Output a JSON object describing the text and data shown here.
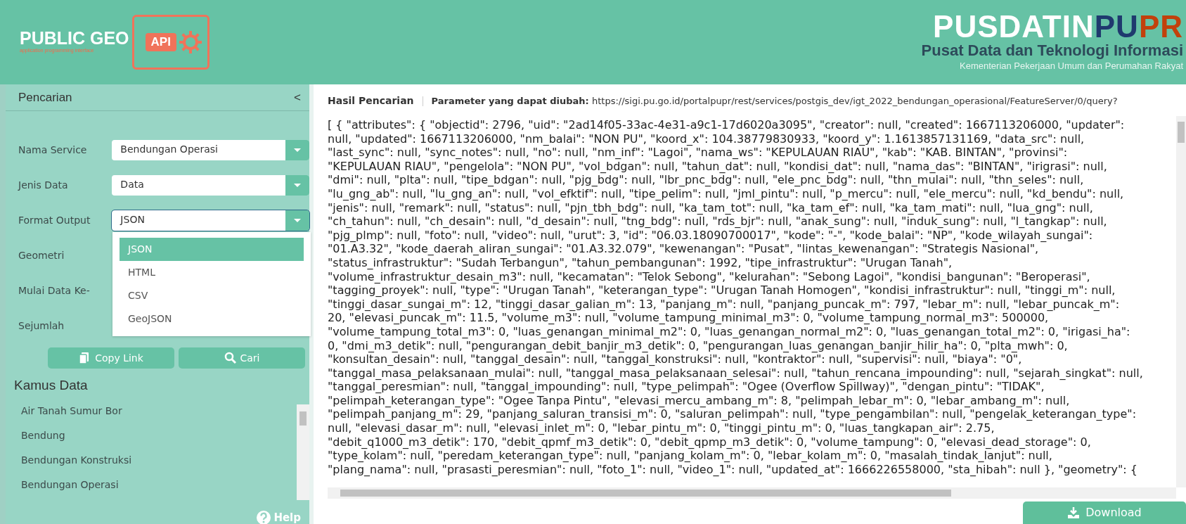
{
  "header": {
    "app_logo": {
      "title": "PUBLIC GEO",
      "badge": "API",
      "tagline": "application programming interface"
    },
    "org_logo": {
      "wordmark": [
        {
          "text": "PUSDATIN",
          "color": "#ffffff"
        },
        {
          "text": "PU",
          "color": "#1f3a6e"
        },
        {
          "text": "PR",
          "color": "#c2410c"
        }
      ],
      "title": "Pusat Data dan Teknologi Informasi",
      "subtitle": "Kementerian Pekerjaan Umum dan Perumahan Rakyat"
    }
  },
  "sidebar": {
    "title": "Pencarian",
    "collapse": "<",
    "fields": [
      {
        "label": "Nama Service",
        "kind": "select",
        "value": "Bendungan Operasi",
        "focused": false
      },
      {
        "label": "Jenis Data",
        "kind": "select",
        "value": "Data",
        "focused": false
      },
      {
        "label": "Format Output",
        "kind": "select",
        "value": "JSON",
        "focused": true
      },
      {
        "label": "Geometri",
        "kind": "hidden"
      },
      {
        "label": "Mulai Data Ke-",
        "kind": "hidden"
      },
      {
        "label": "Sejumlah",
        "kind": "hidden"
      }
    ],
    "dropdown": {
      "options": [
        {
          "label": "JSON",
          "selected": true
        },
        {
          "label": "HTML",
          "selected": false
        },
        {
          "label": "CSV",
          "selected": false
        },
        {
          "label": "GeoJSON",
          "selected": false
        }
      ]
    },
    "buttons": [
      {
        "label": "Copy Link",
        "kind": "copy"
      },
      {
        "label": "Cari",
        "kind": "search"
      }
    ],
    "dictionary": {
      "title": "Kamus Data",
      "items": [
        "Air Tanah Sumur Bor",
        "Bendung",
        "Bendungan Konstruksi",
        "Bendungan Operasi"
      ]
    },
    "help": "Help"
  },
  "result": {
    "tab": "Hasil Pencarian",
    "parameter": "**Parameter yang dapat diubah:** https://sigi.pu.go.id/portalpupr/rest/services/postgis_dev/igt_2022_bendungan_operasional/FeatureServer/0/query?",
    "lines": [
      "[ { \"attributes\": { \"objectid\": 2796, \"uid\": \"2ad14f05-33ac-4e31-a9c1-17d6020a3095\", \"creator\": null, \"created\": 1667113206000, \"updater\":",
      "null, \"updated\": 1667113206000, \"nm_balai\": \"NON PU\", \"koord_x\": 104.38779830933, \"koord_y\": 1.1613857131169, \"data_src\": null,",
      "\"last_sync\": null, \"sync_notes\": null, \"no\": null, \"nm_inf\": \"Lagoi\", \"nama_ws\": \"KEPULAUAN RIAU\", \"kab\": \"KAB. BINTAN\", \"provinsi\":",
      "\"KEPULAUAN RIAU\", \"pengelola\": \"NON PU\", \"vol_bdgan\": null, \"tahun_dat\": null, \"kondisi_dat\": null, \"nama_das\": \"BINTAN\", \"irigrasi\": null,",
      "\"dmi\": null, \"plta\": null, \"tipe_bdgan\": null, \"pjg_bdg\": null, \"lbr_pnc_bdg\": null, \"ele_pnc_bdg\": null, \"thn_mulai\": null, \"thn_seles\": null,",
      "\"lu_gng_ab\": null, \"lu_gng_an\": null, \"vol_efktif\": null, \"tipe_pelim\": null, \"jml_pintu\": null, \"p_mercu\": null, \"ele_mercu\": null, \"kd_bendu\": null,",
      "\"jenis\": null, \"remark\": null, \"status\": null, \"pjn_tbh_bdg\": null, \"ka_tam_tot\": null, \"ka_tam_ef\": null, \"ka_tam_mati\": null, \"lua_gng\": null,",
      "\"ch_tahun\": null, \"ch_desain\": null, \"d_desain\": null, \"tng_bdg\": null, \"rds_bjr\": null, \"anak_sung\": null, \"induk_sung\": null, \"l_tangkap\": null,",
      "\"pjg_plmp\": null, \"foto\": null, \"video\": null, \"urut\": 3, \"id\": \"06.03.18090700017\", \"kode\": \"-\", \"kode_balai\": \"NP\", \"kode_wilayah_sungai\":",
      "\"01.A3.32\", \"kode_daerah_aliran_sungai\": \"01.A3.32.079\", \"kewenangan\": \"Pusat\", \"lintas_kewenangan\": \"Strategis Nasional\",",
      "\"status_infrastruktur\": \"Sudah Terbangun\", \"tahun_pembangunan\": 1992, \"tipe_infrastruktur\": \"Urugan Tanah\",",
      "\"volume_infrastruktur_desain_m3\": null, \"kecamatan\": \"Telok Sebong\", \"kelurahan\": \"Sebong Lagoi\", \"kondisi_bangunan\": \"Beroperasi\",",
      "\"tagging_proyek\": null, \"type\": \"Urugan Tanah\", \"keterangan_type\": \"Urugan Tanah Homogen\", \"kondisi_infrastruktur\": null, \"tinggi_m\": null,",
      "\"tinggi_dasar_sungai_m\": 12, \"tinggi_dasar_galian_m\": 13, \"panjang_m\": null, \"panjang_puncak_m\": 797, \"lebar_m\": null, \"lebar_puncak_m\":",
      "20, \"elevasi_puncak_m\": 11.5, \"volume_m3\": null, \"volume_tampung_minimal_m3\": 0, \"volume_tampung_normal_m3\": 500000,",
      "\"volume_tampung_total_m3\": 0, \"luas_genangan_minimal_m2\": 0, \"luas_genangan_normal_m2\": 0, \"luas_genangan_total_m2\": 0, \"irigasi_ha\":",
      "0, \"dmi_m3_detik\": null, \"pengurangan_debit_banjir_m3_detik\": 0, \"pengurangan_luas_genangan_banjir_hilir_ha\": 0, \"plta_mwh\": 0,",
      "\"konsultan_desain\": null, \"tanggal_desain\": null, \"tanggal_konstruksi\": null, \"kontraktor\": null, \"supervisi\": null, \"biaya\": \"0\",",
      "\"tanggal_masa_pelaksanaan_mulai\": null, \"tanggal_masa_pelaksanaan_selesai\": null, \"tahun_rencana_impounding\": null, \"sejarah_singkat\": null,",
      "\"tanggal_peresmian\": null, \"tanggal_impounding\": null, \"type_pelimpah\": \"Ogee (Overflow Spillway)\", \"dengan_pintu\": \"TIDAK\",",
      "\"pelimpah_keterangan_type\": \"Ogee Tanpa Pintu\", \"elevasi_mercu_ambang_m\": 8, \"pelimpah_lebar_m\": 0, \"lebar_ambang_m\": null,",
      "\"pelimpah_panjang_m\": 29, \"panjang_saluran_transisi_m\": 0, \"saluran_pelimpah\": null, \"type_pengambilan\": null, \"pengelak_keterangan_type\":",
      "null, \"elevasi_dasar_m\": null, \"elevasi_inlet_m\": 0, \"lebar_pintu_m\": 0, \"tinggi_pintu_m\": 0, \"luas_tangkapan_air\": 2.75,",
      "\"debit_q1000_m3_detik\": 170, \"debit_qpmf_m3_detik\": 0, \"debit_qpmp_m3_detik\": 0, \"volume_tampung\": 0, \"elevasi_dead_storage\": 0,",
      "\"type_kolam\": null, \"peredam_keterangan_type\": null, \"panjang_kolam_m\": 0, \"lebar_kolam_m\": 0, \"masalah_tindak_lanjut\": null,",
      "\"plang_nama\": null, \"prasasti_peresmian\": null, \"foto_1\": null, \"video_1\": null, \"updated_at\": 1666226558000, \"sta_hibah\": null }, \"geometry\": {"
    ],
    "download": "Download"
  }
}
